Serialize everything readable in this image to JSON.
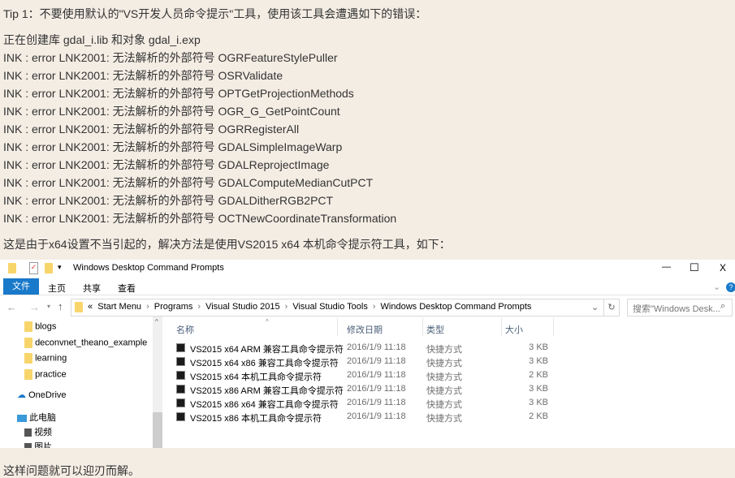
{
  "article": {
    "tip": "Tip 1：不要使用默认的\"VS开发人员命令提示\"工具，使用该工具会遭遇如下的错误：",
    "log": [
      "正在创建库 gdal_i.lib 和对象 gdal_i.exp",
      "INK : error LNK2001: 无法解析的外部符号 OGRFeatureStylePuller",
      "INK : error LNK2001: 无法解析的外部符号 OSRValidate",
      "INK : error LNK2001: 无法解析的外部符号 OPTGetProjectionMethods",
      "INK : error LNK2001: 无法解析的外部符号 OGR_G_GetPointCount",
      "INK : error LNK2001: 无法解析的外部符号 OGRRegisterAll",
      "INK : error LNK2001: 无法解析的外部符号 GDALSimpleImageWarp",
      "INK : error LNK2001: 无法解析的外部符号 GDALReprojectImage",
      "INK : error LNK2001: 无法解析的外部符号 GDALComputeMedianCutPCT",
      "INK : error LNK2001: 无法解析的外部符号 GDALDitherRGB2PCT",
      "INK : error LNK2001: 无法解析的外部符号 OCTNewCoordinateTransformation"
    ],
    "reason": "这是由于x64设置不当引起的，解决方法是使用VS2015 x64 本机命令提示符工具，如下：",
    "conclusion": "这样问题就可以迎刃而解。"
  },
  "explorer": {
    "title": "Windows Desktop Command Prompts",
    "window_buttons": {
      "minimize": "—",
      "maximize": "☐",
      "close": "X"
    },
    "ribbon": {
      "file": "文件",
      "tabs": [
        "主页",
        "共享",
        "查看"
      ],
      "help": "?"
    },
    "address": {
      "prefix": "«",
      "crumbs": [
        "Start Menu",
        "Programs",
        "Visual Studio 2015",
        "Visual Studio Tools",
        "Windows Desktop Command Prompts"
      ]
    },
    "search_placeholder": "搜索\"Windows Desk...",
    "sidebar": {
      "folders": [
        "blogs",
        "deconvnet_theano_example",
        "learning",
        "practice"
      ],
      "onedrive": "OneDrive",
      "this_pc": "此电脑",
      "pc_items": [
        "视频",
        "图片"
      ]
    },
    "columns": [
      "名称",
      "修改日期",
      "类型",
      "大小"
    ],
    "files": [
      {
        "name": "VS2015 x64 ARM 兼容工具命令提示符",
        "date": "2016/1/9 11:18",
        "type": "快捷方式",
        "size": "3 KB"
      },
      {
        "name": "VS2015 x64 x86 兼容工具命令提示符",
        "date": "2016/1/9 11:18",
        "type": "快捷方式",
        "size": "3 KB"
      },
      {
        "name": "VS2015 x64 本机工具命令提示符",
        "date": "2016/1/9 11:18",
        "type": "快捷方式",
        "size": "2 KB"
      },
      {
        "name": "VS2015 x86 ARM 兼容工具命令提示符",
        "date": "2016/1/9 11:18",
        "type": "快捷方式",
        "size": "3 KB"
      },
      {
        "name": "VS2015 x86 x64 兼容工具命令提示符",
        "date": "2016/1/9 11:18",
        "type": "快捷方式",
        "size": "3 KB"
      },
      {
        "name": "VS2015 x86 本机工具命令提示符",
        "date": "2016/1/9 11:18",
        "type": "快捷方式",
        "size": "2 KB"
      }
    ],
    "colors": {
      "file_tab": "#1979ca",
      "folder": "#f7d56b"
    }
  }
}
